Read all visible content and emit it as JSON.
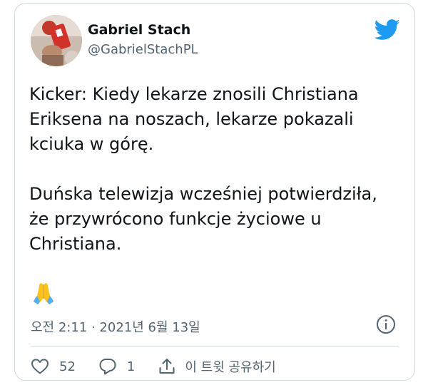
{
  "author": {
    "name": "Gabriel Stach",
    "handle": "@GabrielStachPL"
  },
  "tweet": {
    "paragraphs": [
      "Kicker: Kiedy lekarze znosili Christiana Eriksena na noszach, lekarze pokazali kciuka w górę.",
      "Duńska telewizja wcześniej potwierdziła, że przywrócono funkcje życiowe u Christiana."
    ],
    "emoji": "🙏",
    "timestamp": "오전 2:11 · 2021년 6월 13일"
  },
  "actions": {
    "likes": "52",
    "replies": "1",
    "share_label": "이 트윗 공유하기"
  },
  "icons": {
    "brand": "twitter-bird-icon",
    "info": "info-icon",
    "like": "heart-icon",
    "reply": "reply-icon",
    "share": "share-icon"
  },
  "colors": {
    "twitter_blue": "#1d9bf0",
    "secondary_text": "#536471",
    "border": "#cfd9de"
  }
}
